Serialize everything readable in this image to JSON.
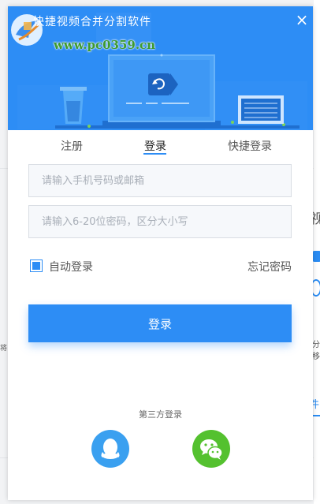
{
  "window": {
    "title": "快捷视频合并分割软件",
    "watermark": "www.pc0359.cn",
    "close_glyph": "×"
  },
  "tabs": [
    {
      "label": "注册",
      "active": false
    },
    {
      "label": "登录",
      "active": true
    },
    {
      "label": "快捷登录",
      "active": false
    }
  ],
  "form": {
    "account_placeholder": "请输入手机号码或邮箱",
    "account_value": "",
    "password_placeholder": "请输入6-20位密码，区分大小写",
    "password_value": "",
    "remember_label": "自动登录",
    "remember_checked": true,
    "forgot_label": "忘记密码",
    "login_label": "登录"
  },
  "third_party": {
    "title": "第三方登录",
    "providers": [
      {
        "name": "qq-icon",
        "color": "#3aa0f0"
      },
      {
        "name": "wechat-icon",
        "color": "#54c12f"
      }
    ]
  },
  "background_app": {
    "glyphs": [
      "视",
      "将",
      "分",
      "移",
      "件"
    ]
  },
  "colors": {
    "accent": "#2d8df5",
    "qq": "#3aa0f0",
    "wechat": "#54c12f"
  }
}
